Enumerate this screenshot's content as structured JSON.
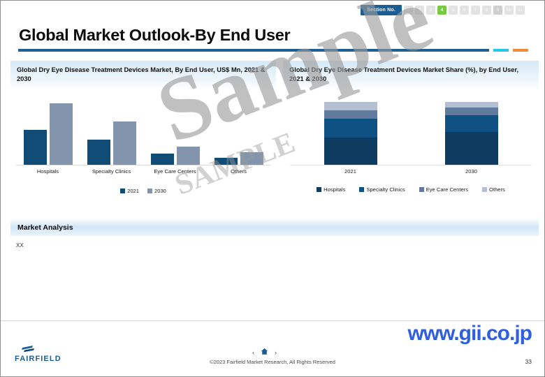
{
  "header": {
    "section_badge_label": "Section No.",
    "section_numbers": [
      "1",
      "2",
      "3",
      "4",
      "5",
      "6",
      "7",
      "8",
      "9",
      "10",
      "11"
    ],
    "active_section": "4",
    "dim_sections": [
      "9"
    ],
    "accent_blue": "#1f5f94",
    "accent_cyan": "#28c8e6",
    "accent_orange": "#f0893c",
    "active_green": "#7ac943"
  },
  "slide": {
    "title": "Global Market Outlook-By End User"
  },
  "panels": {
    "left": {
      "title": "Global Dry Eye Disease Treatment Devices Market, By End User, US$ Mn, 2021 & 2030"
    },
    "right": {
      "title": "Global Dry Eye Disease Treatment Devices Market Share (%), by End User, 2021 & 2030"
    }
  },
  "market_analysis": {
    "heading": "Market Analysis",
    "body": "XX"
  },
  "watermark": {
    "primary": "Sample",
    "secondary": "SAMPLE"
  },
  "footer": {
    "logo_text": "FAIRFIELD",
    "prev_icon": "chevron-left-icon",
    "home_icon": "home-icon",
    "next_icon": "chevron-right-icon",
    "prev_glyph": "‹",
    "home_glyph": "⌂",
    "next_glyph": "›",
    "copyright": "©2023 Fairfield Market Research, All Rights Reserved",
    "page_number": "33",
    "url": "www.gii.co.jp"
  },
  "chart_data": [
    {
      "type": "bar",
      "id": "end-user-revenue",
      "title": "Global Dry Eye Disease Treatment Devices Market, By End User, US$ Mn, 2021 & 2030",
      "categories": [
        "Hospitals",
        "Specialty Clinics",
        "Eye Care Centers",
        "Others"
      ],
      "series": [
        {
          "name": "2021",
          "color": "#104c75",
          "values": [
            42,
            30,
            13,
            8
          ]
        },
        {
          "name": "2030",
          "color": "#8295ad",
          "values": [
            73,
            52,
            22,
            15
          ]
        }
      ],
      "xlabel": "",
      "ylabel": "US$ Mn",
      "ylim": [
        0,
        80
      ],
      "grid": false,
      "legend_position": "bottom",
      "axis_tick_labels": []
    },
    {
      "type": "bar",
      "subtype": "stacked",
      "id": "end-user-share",
      "title": "Global Dry Eye Disease Treatment Devices Market Share (%), by End User, 2021 & 2030",
      "categories": [
        "2021",
        "2030"
      ],
      "series": [
        {
          "name": "Hospitals",
          "color": "#0d3c60",
          "values": [
            43,
            52
          ]
        },
        {
          "name": "Specialty Clinics",
          "color": "#0e5182",
          "values": [
            30,
            27
          ]
        },
        {
          "name": "Eye Care Centers",
          "color": "#617b9e",
          "values": [
            14,
            12
          ]
        },
        {
          "name": "Others",
          "color": "#b4c0d2",
          "values": [
            13,
            9
          ]
        }
      ],
      "xlabel": "",
      "ylabel": "%",
      "ylim": [
        0,
        100
      ],
      "grid": false,
      "legend_position": "bottom"
    }
  ]
}
